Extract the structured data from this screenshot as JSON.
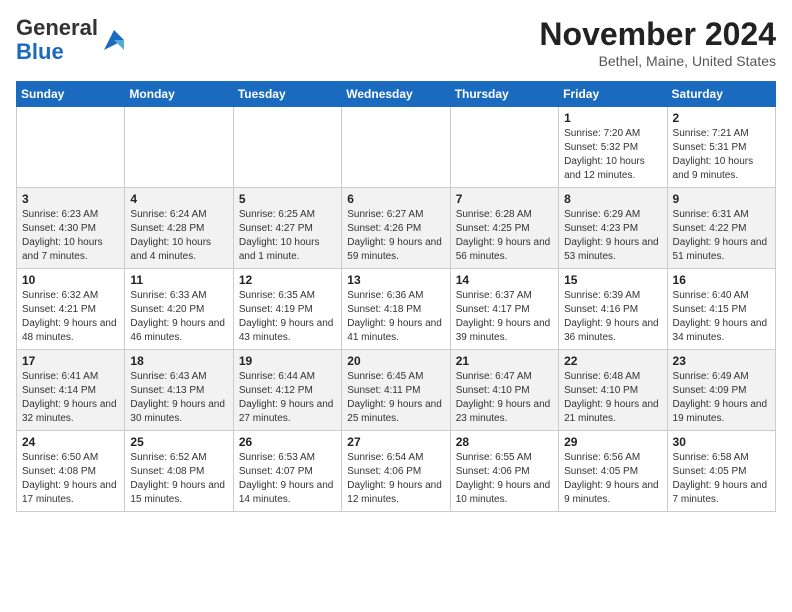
{
  "header": {
    "logo_general": "General",
    "logo_blue": "Blue",
    "month": "November 2024",
    "location": "Bethel, Maine, United States"
  },
  "days_of_week": [
    "Sunday",
    "Monday",
    "Tuesday",
    "Wednesday",
    "Thursday",
    "Friday",
    "Saturday"
  ],
  "weeks": [
    [
      {
        "day": "",
        "info": ""
      },
      {
        "day": "",
        "info": ""
      },
      {
        "day": "",
        "info": ""
      },
      {
        "day": "",
        "info": ""
      },
      {
        "day": "",
        "info": ""
      },
      {
        "day": "1",
        "info": "Sunrise: 7:20 AM\nSunset: 5:32 PM\nDaylight: 10 hours and 12 minutes."
      },
      {
        "day": "2",
        "info": "Sunrise: 7:21 AM\nSunset: 5:31 PM\nDaylight: 10 hours and 9 minutes."
      }
    ],
    [
      {
        "day": "3",
        "info": "Sunrise: 6:23 AM\nSunset: 4:30 PM\nDaylight: 10 hours and 7 minutes."
      },
      {
        "day": "4",
        "info": "Sunrise: 6:24 AM\nSunset: 4:28 PM\nDaylight: 10 hours and 4 minutes."
      },
      {
        "day": "5",
        "info": "Sunrise: 6:25 AM\nSunset: 4:27 PM\nDaylight: 10 hours and 1 minute."
      },
      {
        "day": "6",
        "info": "Sunrise: 6:27 AM\nSunset: 4:26 PM\nDaylight: 9 hours and 59 minutes."
      },
      {
        "day": "7",
        "info": "Sunrise: 6:28 AM\nSunset: 4:25 PM\nDaylight: 9 hours and 56 minutes."
      },
      {
        "day": "8",
        "info": "Sunrise: 6:29 AM\nSunset: 4:23 PM\nDaylight: 9 hours and 53 minutes."
      },
      {
        "day": "9",
        "info": "Sunrise: 6:31 AM\nSunset: 4:22 PM\nDaylight: 9 hours and 51 minutes."
      }
    ],
    [
      {
        "day": "10",
        "info": "Sunrise: 6:32 AM\nSunset: 4:21 PM\nDaylight: 9 hours and 48 minutes."
      },
      {
        "day": "11",
        "info": "Sunrise: 6:33 AM\nSunset: 4:20 PM\nDaylight: 9 hours and 46 minutes."
      },
      {
        "day": "12",
        "info": "Sunrise: 6:35 AM\nSunset: 4:19 PM\nDaylight: 9 hours and 43 minutes."
      },
      {
        "day": "13",
        "info": "Sunrise: 6:36 AM\nSunset: 4:18 PM\nDaylight: 9 hours and 41 minutes."
      },
      {
        "day": "14",
        "info": "Sunrise: 6:37 AM\nSunset: 4:17 PM\nDaylight: 9 hours and 39 minutes."
      },
      {
        "day": "15",
        "info": "Sunrise: 6:39 AM\nSunset: 4:16 PM\nDaylight: 9 hours and 36 minutes."
      },
      {
        "day": "16",
        "info": "Sunrise: 6:40 AM\nSunset: 4:15 PM\nDaylight: 9 hours and 34 minutes."
      }
    ],
    [
      {
        "day": "17",
        "info": "Sunrise: 6:41 AM\nSunset: 4:14 PM\nDaylight: 9 hours and 32 minutes."
      },
      {
        "day": "18",
        "info": "Sunrise: 6:43 AM\nSunset: 4:13 PM\nDaylight: 9 hours and 30 minutes."
      },
      {
        "day": "19",
        "info": "Sunrise: 6:44 AM\nSunset: 4:12 PM\nDaylight: 9 hours and 27 minutes."
      },
      {
        "day": "20",
        "info": "Sunrise: 6:45 AM\nSunset: 4:11 PM\nDaylight: 9 hours and 25 minutes."
      },
      {
        "day": "21",
        "info": "Sunrise: 6:47 AM\nSunset: 4:10 PM\nDaylight: 9 hours and 23 minutes."
      },
      {
        "day": "22",
        "info": "Sunrise: 6:48 AM\nSunset: 4:10 PM\nDaylight: 9 hours and 21 minutes."
      },
      {
        "day": "23",
        "info": "Sunrise: 6:49 AM\nSunset: 4:09 PM\nDaylight: 9 hours and 19 minutes."
      }
    ],
    [
      {
        "day": "24",
        "info": "Sunrise: 6:50 AM\nSunset: 4:08 PM\nDaylight: 9 hours and 17 minutes."
      },
      {
        "day": "25",
        "info": "Sunrise: 6:52 AM\nSunset: 4:08 PM\nDaylight: 9 hours and 15 minutes."
      },
      {
        "day": "26",
        "info": "Sunrise: 6:53 AM\nSunset: 4:07 PM\nDaylight: 9 hours and 14 minutes."
      },
      {
        "day": "27",
        "info": "Sunrise: 6:54 AM\nSunset: 4:06 PM\nDaylight: 9 hours and 12 minutes."
      },
      {
        "day": "28",
        "info": "Sunrise: 6:55 AM\nSunset: 4:06 PM\nDaylight: 9 hours and 10 minutes."
      },
      {
        "day": "29",
        "info": "Sunrise: 6:56 AM\nSunset: 4:05 PM\nDaylight: 9 hours and 9 minutes."
      },
      {
        "day": "30",
        "info": "Sunrise: 6:58 AM\nSunset: 4:05 PM\nDaylight: 9 hours and 7 minutes."
      }
    ]
  ]
}
